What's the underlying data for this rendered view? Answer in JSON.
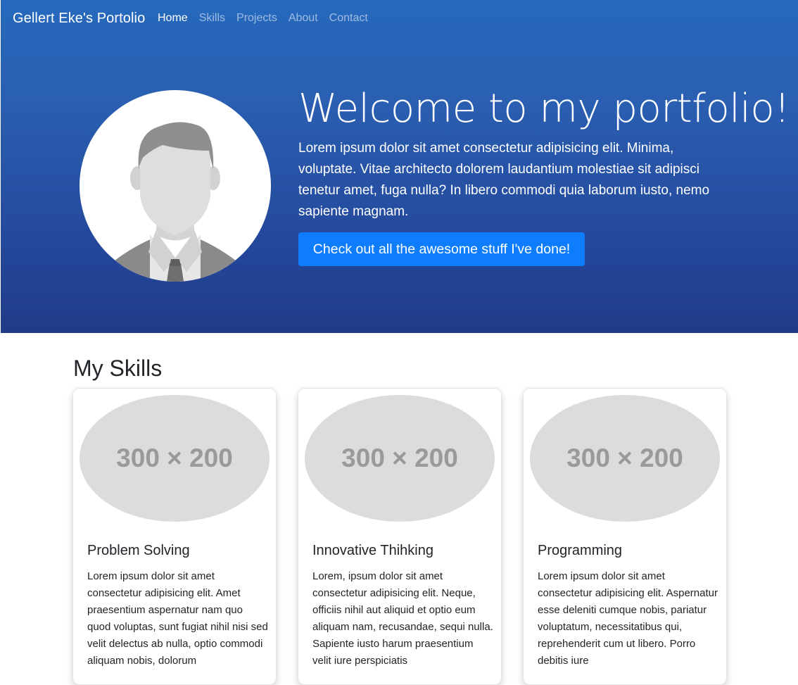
{
  "nav": {
    "brand": "Gellert Eke's Portolio",
    "links": [
      {
        "label": "Home",
        "active": true
      },
      {
        "label": "Skills",
        "active": false
      },
      {
        "label": "Projects",
        "active": false
      },
      {
        "label": "About",
        "active": false
      },
      {
        "label": "Contact",
        "active": false
      }
    ]
  },
  "hero": {
    "avatar_icon": "default-user-avatar-icon",
    "title": "Welcome to my portfolio!",
    "text": "Lorem ipsum dolor sit amet consectetur adipisicing elit. Minima, voluptate. Vitae architecto dolorem laudantium molestiae sit adipisci tenetur amet, fuga nulla? In libero commodi quia laborum iusto, nemo sapiente magnam.",
    "button": "Check out all the awesome stuff I've done!"
  },
  "skills": {
    "title": "My Skills",
    "cards": [
      {
        "image_placeholder": "300 × 200",
        "title": "Problem Solving",
        "text": "Lorem ipsum dolor sit amet consectetur adipisicing elit. Amet praesentium aspernatur nam quo quod voluptas, sunt fugiat nihil nisi sed velit delectus ab nulla, optio commodi aliquam nobis, dolorum"
      },
      {
        "image_placeholder": "300 × 200",
        "title": "Innovative Thihking",
        "text": "Lorem, ipsum dolor sit amet consectetur adipisicing elit. Neque, officiis nihil aut aliquid et optio eum aliquam nam, recusandae, sequi nulla. Sapiente iusto harum praesentium velit iure perspiciatis"
      },
      {
        "image_placeholder": "300 × 200",
        "title": "Programming",
        "text": "Lorem ipsum dolor sit amet consectetur adipisicing elit. Aspernatur esse deleniti cumque nobis, pariatur voluptatum, necessitatibus qui, reprehenderit cum ut libero. Porro debitis iure"
      }
    ]
  },
  "colors": {
    "hero_gradient_top": "#2669bd",
    "hero_gradient_bottom": "#203c88",
    "button": "#0d7dfd",
    "placeholder": "#dcdcdc"
  }
}
